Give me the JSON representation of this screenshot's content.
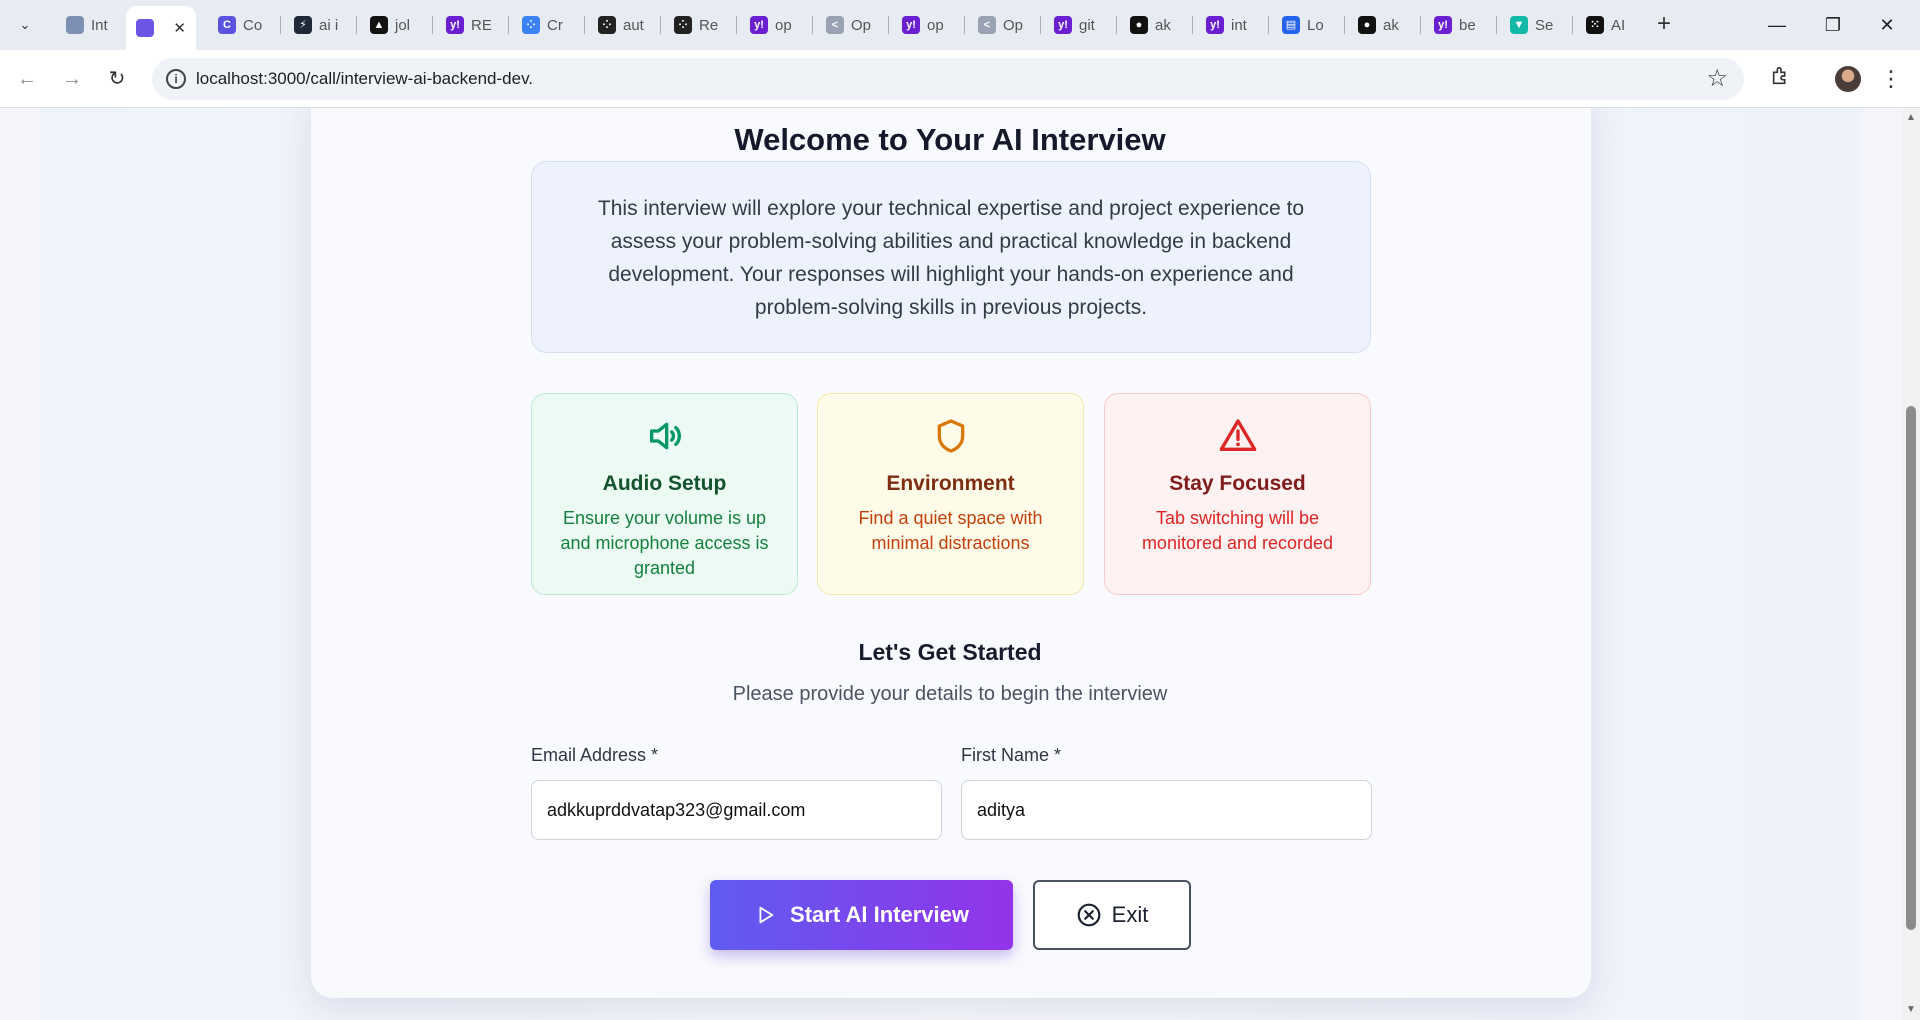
{
  "browser": {
    "tabs": [
      {
        "label": "Int",
        "color": "#7d8fb3",
        "glyph": ""
      },
      {
        "label": "",
        "color": "#6f55e6",
        "glyph": "",
        "active": true
      },
      {
        "label": "Co",
        "color": "#5b52e0",
        "glyph": "C"
      },
      {
        "label": "ai i",
        "color": "#1f2937",
        "glyph": "⚡"
      },
      {
        "label": "jol",
        "color": "#111111",
        "glyph": "▲"
      },
      {
        "label": "RE",
        "color": "#6a1fd0",
        "glyph": "y!"
      },
      {
        "label": "Cr",
        "color": "#3b82f6",
        "glyph": "⁘"
      },
      {
        "label": "aut",
        "color": "#222222",
        "glyph": "⁘"
      },
      {
        "label": "Re",
        "color": "#222222",
        "glyph": "⁘"
      },
      {
        "label": "op",
        "color": "#6a1fd0",
        "glyph": "y!"
      },
      {
        "label": "Op",
        "color": "#9aa3b2",
        "glyph": "<"
      },
      {
        "label": "op",
        "color": "#6a1fd0",
        "glyph": "y!"
      },
      {
        "label": "Op",
        "color": "#9aa3b2",
        "glyph": "<"
      },
      {
        "label": "git",
        "color": "#6a1fd0",
        "glyph": "y!"
      },
      {
        "label": "ak",
        "color": "#111111",
        "glyph": "●"
      },
      {
        "label": "int",
        "color": "#6a1fd0",
        "glyph": "y!"
      },
      {
        "label": "Lo",
        "color": "#2563eb",
        "glyph": "▤"
      },
      {
        "label": "ak",
        "color": "#111111",
        "glyph": "●"
      },
      {
        "label": "be",
        "color": "#6a1fd0",
        "glyph": "y!"
      },
      {
        "label": "Se",
        "color": "#14b8a6",
        "glyph": "▼"
      },
      {
        "label": "AI",
        "color": "#111111",
        "glyph": "⁙"
      }
    ],
    "url": "localhost:3000/call/interview-ai-backend-dev.",
    "icons": {
      "tab_menu": "chevron-down-icon",
      "back": "back-arrow-icon",
      "forward": "forward-arrow-icon",
      "reload": "reload-icon",
      "site_info": "info-icon",
      "bookmark": "star-icon",
      "extensions": "puzzle-icon",
      "menu": "kebab-menu-icon"
    }
  },
  "main": {
    "title": "Welcome to Your AI Interview",
    "description": "This interview will explore your technical expertise and project experience to assess your problem-solving abilities and practical knowledge in backend development. Your responses will highlight your hands-on experience and problem-solving skills in previous projects.",
    "features": [
      {
        "heading": "Audio Setup",
        "text": "Ensure your volume is up and microphone access is granted",
        "icon": "speaker-icon",
        "color": "#059669"
      },
      {
        "heading": "Environment",
        "text": "Find a quiet space with minimal distractions",
        "icon": "shield-icon",
        "color": "#d97706"
      },
      {
        "heading": "Stay Focused",
        "text": "Tab switching will be monitored and recorded",
        "icon": "warning-triangle-icon",
        "color": "#dc2626"
      }
    ],
    "form_title": "Let's Get Started",
    "form_subtitle": "Please provide your details to begin the interview",
    "email_label": "Email Address *",
    "email_value": "adkkuprddvatap323@gmail.com",
    "name_label": "First Name *",
    "name_value": "aditya",
    "start_label": "Start AI Interview",
    "exit_label": "Exit"
  }
}
